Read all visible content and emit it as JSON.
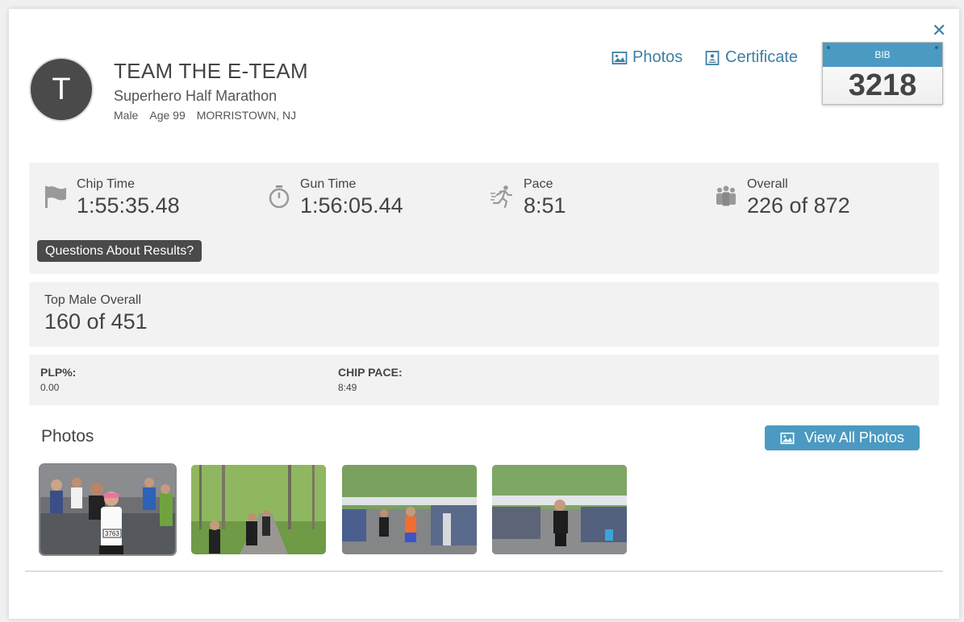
{
  "close_label": "✕",
  "athlete": {
    "initial": "T",
    "name": "TEAM THE E-TEAM",
    "event": "Superhero Half Marathon",
    "gender": "Male",
    "age": "Age 99",
    "location": "MORRISTOWN, NJ"
  },
  "links": {
    "photos": "Photos",
    "certificate": "Certificate"
  },
  "bib": {
    "label": "BIB",
    "number": "3218"
  },
  "stats": [
    {
      "label": "Chip Time",
      "value": "1:55:35.48",
      "icon": "flag-icon"
    },
    {
      "label": "Gun Time",
      "value": "1:56:05.44",
      "icon": "stopwatch-icon"
    },
    {
      "label": "Pace",
      "value": "8:51",
      "icon": "runner-icon"
    },
    {
      "label": "Overall",
      "value": "226 of 872",
      "icon": "group-icon"
    }
  ],
  "questions_label": "Questions About Results?",
  "division": {
    "label": "Top Male Overall",
    "value": "160 of 451"
  },
  "extra": [
    {
      "key": "PLP%:",
      "value": "0.00"
    },
    {
      "key": "CHIP PACE:",
      "value": "8:49"
    }
  ],
  "photos": {
    "title": "Photos",
    "view_all": "View All Photos",
    "thumbnails": [
      {
        "bib_text": "3763"
      },
      {
        "bib_text": ""
      },
      {
        "bib_text": ""
      },
      {
        "bib_text": ""
      }
    ]
  },
  "colors": {
    "accent": "#3d7fa6",
    "bib_header": "#4b9ac2",
    "panel_bg": "#f2f2f3",
    "dark_button": "#4a4a4a"
  }
}
